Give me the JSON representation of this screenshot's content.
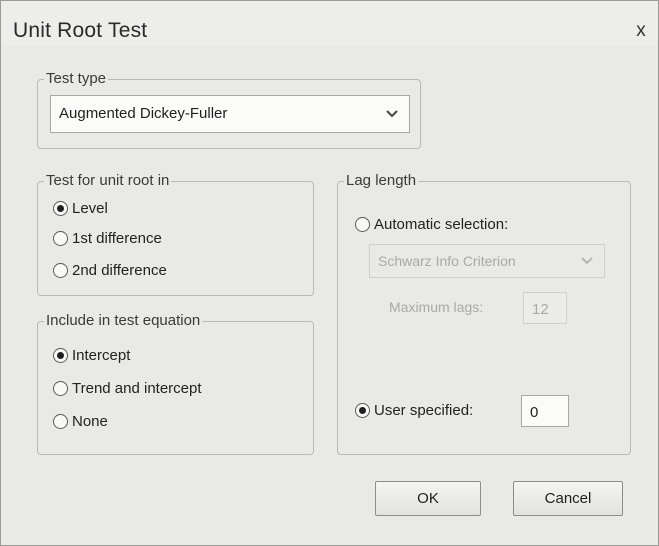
{
  "window": {
    "title": "Unit Root Test",
    "close_label": "x"
  },
  "test_type": {
    "legend": "Test type",
    "selected": "Augmented Dickey-Fuller"
  },
  "unit_root_in": {
    "legend": "Test for unit root in",
    "options": [
      "Level",
      "1st difference",
      "2nd difference"
    ],
    "selected": "Level"
  },
  "include": {
    "legend": "Include in test equation",
    "options": [
      "Intercept",
      "Trend and intercept",
      "None"
    ],
    "selected": "Intercept"
  },
  "lag_length": {
    "legend": "Lag length",
    "automatic_label": "Automatic selection:",
    "criterion": "Schwarz Info Criterion",
    "max_lags_label": "Maximum lags:",
    "max_lags_value": "12",
    "user_label": "User specified:",
    "user_value": "0",
    "selected": "User specified"
  },
  "buttons": {
    "ok": "OK",
    "cancel": "Cancel"
  },
  "icons": {
    "dropdown": "chevron-down-icon",
    "close": "close-icon"
  }
}
